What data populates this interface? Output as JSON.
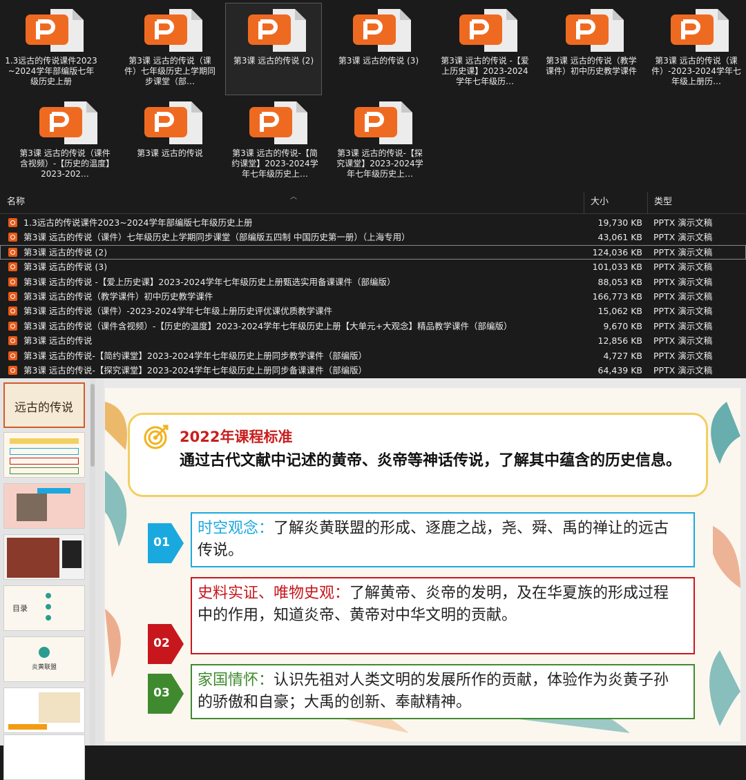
{
  "tiles": [
    {
      "label": "1.3远古的传说课件2023~2024学年部编版七年级历史上册"
    },
    {
      "label": "第3课  远古的传说（课件）七年级历史上学期同步课堂（部…"
    },
    {
      "label": "第3课 远古的传说 (2)"
    },
    {
      "label": "第3课 远古的传说 (3)"
    },
    {
      "label": "第3课 远古的传说 -【爱上历史课】2023-2024学年七年级历…"
    },
    {
      "label": "第3课 远古的传说（教学课件）初中历史教学课件"
    },
    {
      "label": "第3课 远古的传说（课件）-2023-2024学年七年级上册历…"
    },
    {
      "label": "第3课 远古的传说（课件含视频）-【历史的温度】2023-202…"
    },
    {
      "label": "第3课 远古的传说"
    },
    {
      "label": "第3课 远古的传说-【简约课堂】2023-2024学年七年级历史上…"
    },
    {
      "label": "第3课 远古的传说-【探究课堂】2023-2024学年七年级历史上…"
    }
  ],
  "columns": {
    "name": "名称",
    "size": "大小",
    "type": "类型"
  },
  "files": [
    {
      "name": "1.3远古的传说课件2023~2024学年部编版七年级历史上册",
      "size": "19,730 KB",
      "type": "PPTX 演示文稿"
    },
    {
      "name": "第3课  远古的传说（课件）七年级历史上学期同步课堂（部编版五四制 中国历史第一册）（上海专用）",
      "size": "43,061 KB",
      "type": "PPTX 演示文稿"
    },
    {
      "name": "第3课 远古的传说 (2)",
      "size": "124,036 KB",
      "type": "PPTX 演示文稿"
    },
    {
      "name": "第3课 远古的传说 (3)",
      "size": "101,033 KB",
      "type": "PPTX 演示文稿"
    },
    {
      "name": "第3课 远古的传说 -【爱上历史课】2023-2024学年七年级历史上册甄选实用备课课件（部编版）",
      "size": "88,053 KB",
      "type": "PPTX 演示文稿"
    },
    {
      "name": "第3课 远古的传说（教学课件）初中历史教学课件",
      "size": "166,773 KB",
      "type": "PPTX 演示文稿"
    },
    {
      "name": "第3课 远古的传说（课件）-2023-2024学年七年级上册历史评优课优质教学课件",
      "size": "15,062 KB",
      "type": "PPTX 演示文稿"
    },
    {
      "name": "第3课 远古的传说（课件含视频）-【历史的温度】2023-2024学年七年级历史上册【大单元+大观念】精品教学课件（部编版）",
      "size": "9,670 KB",
      "type": "PPTX 演示文稿"
    },
    {
      "name": "第3课 远古的传说",
      "size": "12,856 KB",
      "type": "PPTX 演示文稿"
    },
    {
      "name": "第3课 远古的传说-【简约课堂】2023-2024学年七年级历史上册同步教学课件（部编版）",
      "size": "4,727 KB",
      "type": "PPTX 演示文稿"
    },
    {
      "name": "第3课 远古的传说-【探究课堂】2023-2024学年七年级历史上册同步备课课件（部编版）",
      "size": "64,439 KB",
      "type": "PPTX 演示文稿"
    }
  ],
  "thumbs": [
    {
      "text": "远古的传说"
    },
    {
      "text": ""
    },
    {
      "text": ""
    },
    {
      "text": ""
    },
    {
      "text": "目录"
    },
    {
      "text": "炎黄联盟"
    },
    {
      "text": ""
    },
    {
      "text": ""
    }
  ],
  "slide": {
    "std_title": "2022年课程标准",
    "std_text": "通过古代文献中记述的黄帝、炎帝等神话传说，了解其中蕴含的历史信息。",
    "items": [
      {
        "num": "01",
        "head": "时空观念：",
        "body": "了解炎黄联盟的形成、逐鹿之战，尧、舜、禹的禅让的远古传说。",
        "color": "#1aa9df"
      },
      {
        "num": "02",
        "head": "史料实证、唯物史观：",
        "body": "了解黄帝、炎帝的发明，及在华夏族的形成过程中的作用，知道炎帝、黄帝对中华文明的贡献。",
        "color": "#c8161d"
      },
      {
        "num": "03",
        "head": "家国情怀：",
        "body": "认识先祖对人类文明的发展所作的贡献，体验作为炎黄子孙的骄傲和自豪；大禹的创新、奉献精神。",
        "color": "#3f8a2e"
      }
    ]
  }
}
